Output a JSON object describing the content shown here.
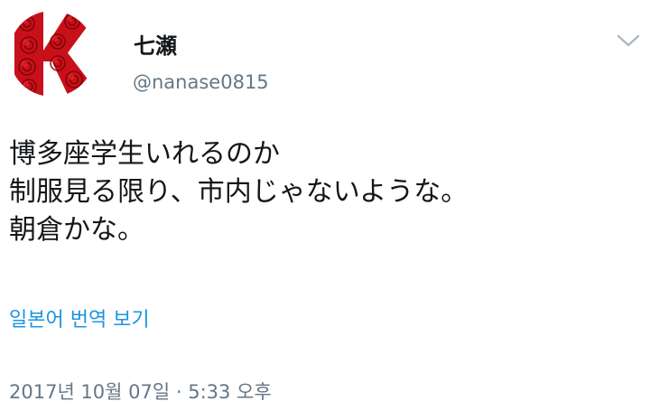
{
  "user": {
    "display_name": "七瀬",
    "screen_name": "@nanase0815",
    "avatar_icon": "rose-k-logo-icon",
    "avatar_color": "#d9161c"
  },
  "tweet": {
    "lines": [
      "博多座学生いれるのか",
      "制服見る限り、市内じゃないような。",
      "朝倉かな。"
    ],
    "translate_label": "일본어 번역 보기",
    "timestamp": "2017년 10월 07일 · 5:33 오후"
  },
  "menu": {
    "caret_icon": "chevron-down-icon"
  },
  "colors": {
    "text": "#14171a",
    "secondary": "#657786",
    "link": "#1b95e0"
  }
}
